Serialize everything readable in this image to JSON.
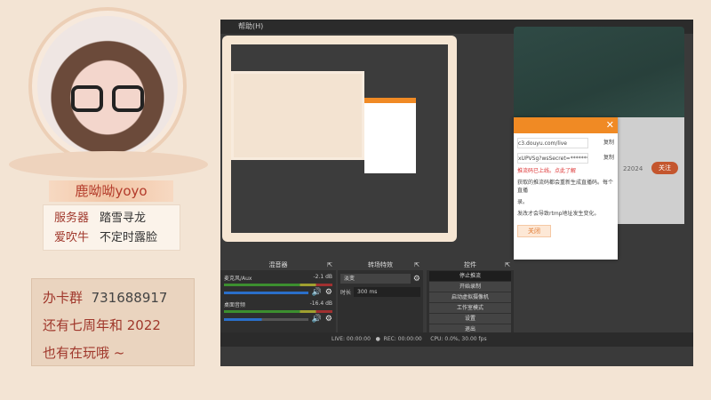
{
  "streamer": {
    "name": "鹿呦呦yoyo",
    "tags": [
      [
        "服务器",
        "踏雪寻龙"
      ],
      [
        "爱吹牛",
        "不定时露脸"
      ]
    ]
  },
  "card": {
    "line1_label": "办卡群",
    "line1_num": "731688917",
    "line2": "还有七周年和 2022",
    "line3": "也有在玩哦 ~"
  },
  "obs": {
    "menu": "帮助(H)",
    "mixer": {
      "title": "混音器",
      "channels": [
        {
          "name": "麦克风/Aux",
          "db": "-2.1 dB"
        },
        {
          "name": "桌面音频",
          "db": "-16.4 dB"
        }
      ]
    },
    "transitions": {
      "title": "转场特效",
      "selected": "淡变",
      "duration_label": "时长",
      "duration": "300 ms"
    },
    "controls": {
      "title": "控件",
      "buttons": [
        "停止推流",
        "开始录制",
        "启动虚拟摄像机",
        "工作室模式",
        "设置",
        "退出"
      ]
    },
    "status": {
      "live": "LIVE: 00:00:00",
      "rec": "REC: 00:00:00",
      "cpu": "CPU: 0.0%, 30.00 fps"
    }
  },
  "dialog": {
    "server": "c3.douyu.com/live",
    "copy1": "复制",
    "key": "xUPVSg?wsSecret=***********",
    "copy2": "复制",
    "notice": "推流码已上线。点此了解",
    "text1": "获取的推流码都会重新生成直播码。每个直播",
    "text2": "录。",
    "text3": "发改才会导致rtmp地址发生变化。",
    "ok": "关闭",
    "count": "22024",
    "follow": "关注"
  }
}
